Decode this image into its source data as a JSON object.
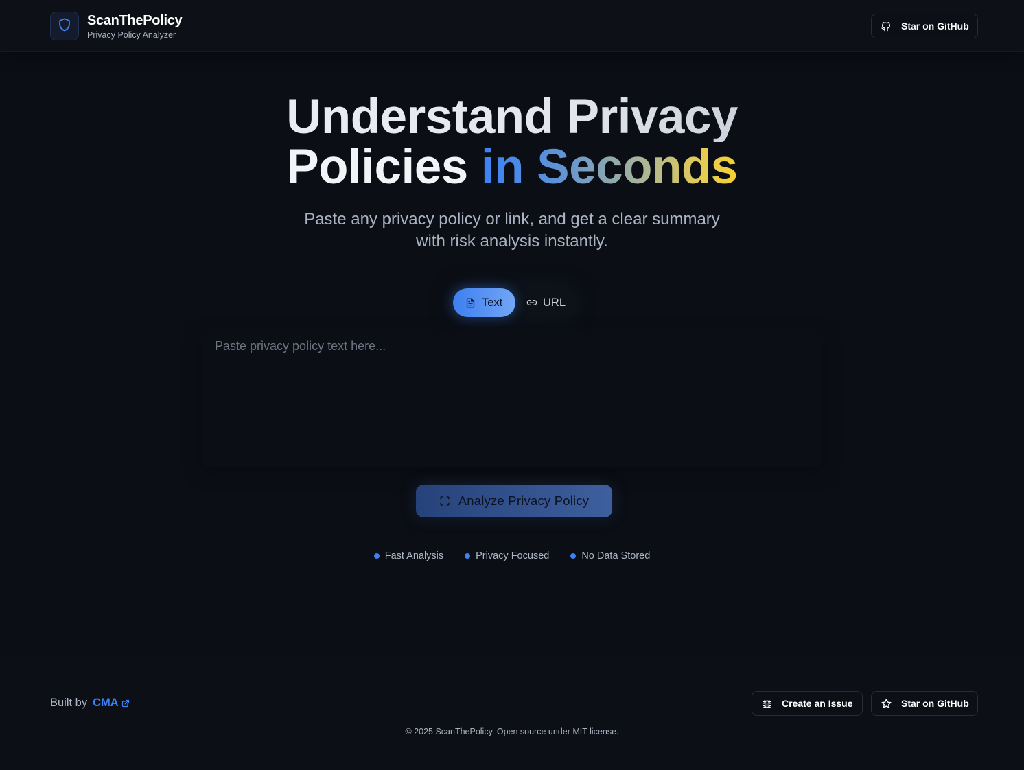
{
  "header": {
    "brand_name": "ScanThePolicy",
    "brand_tagline": "Privacy Policy Analyzer",
    "logo_icon": "shield-icon",
    "github_button_label": "Star on GitHub",
    "github_button_icon": "github-icon"
  },
  "hero": {
    "title_line1": "Understand Privacy",
    "title_line2_plain": "Policies",
    "title_line2_accent": "in Seconds",
    "subtitle_line1": "Paste any privacy policy or link, and get a clear summary",
    "subtitle_line2": "with risk analysis instantly."
  },
  "input_mode_tabs": {
    "selected": "Text",
    "tabs": [
      {
        "label": "Text",
        "icon": "document-icon"
      },
      {
        "label": "URL",
        "icon": "link-icon"
      }
    ]
  },
  "policy_input": {
    "placeholder": "Paste privacy policy text here...",
    "value": ""
  },
  "analyze_button": {
    "label": "Analyze Privacy Policy",
    "icon": "scan-icon"
  },
  "features": [
    {
      "label": "Fast Analysis"
    },
    {
      "label": "Privacy Focused"
    },
    {
      "label": "No Data Stored"
    }
  ],
  "footer": {
    "built_by_prefix": "Built by",
    "built_by_author": "CMA",
    "create_issue_label": "Create an Issue",
    "create_issue_icon": "bug-icon",
    "star_label": "Star on GitHub",
    "star_icon": "star-icon",
    "copyright": "© 2025 ScanThePolicy. Open source under MIT license."
  },
  "colors": {
    "background": "#0b0e14",
    "accent_blue": "#3b82f6",
    "accent_yellow": "#f5d032",
    "text_muted": "#aab3c3"
  }
}
